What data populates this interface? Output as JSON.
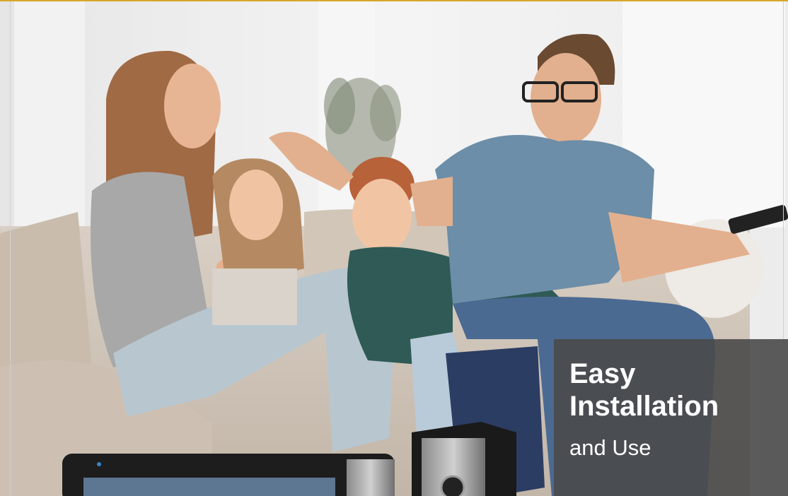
{
  "banner": {
    "headline": [
      "Easy",
      "Installation"
    ],
    "subline": "and Use"
  },
  "colors": {
    "accent_bar": "#d7a72b",
    "overlay": "#4a4a4a",
    "text": "#ffffff"
  }
}
